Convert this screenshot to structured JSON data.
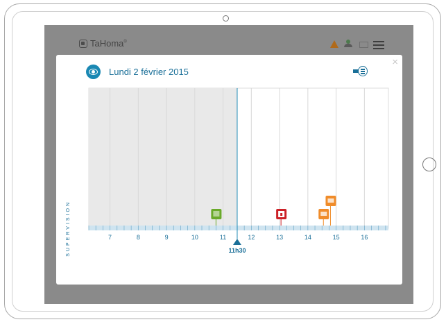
{
  "app": {
    "brand": "TaHoma",
    "brand_mark": "®"
  },
  "header_icons": [
    "warning-icon",
    "user-icon",
    "mail-icon",
    "menu-icon"
  ],
  "dialog": {
    "title": "Lundi 2 février 2015",
    "close_label": "×",
    "side_label": "SUPERVISION"
  },
  "colors": {
    "accent": "#1a88b3",
    "past_shade": "#e9e9e9",
    "green": "#6aaa2a",
    "red": "#cc2127",
    "orange": "#f08c2a"
  },
  "chart_data": {
    "type": "timeline",
    "xlim": [
      6.25,
      16.85
    ],
    "x_ticks": [
      7,
      8,
      9,
      10,
      11,
      12,
      13,
      14,
      15,
      16
    ],
    "tick_labels": [
      "7",
      "8",
      "9",
      "10",
      "11",
      "12",
      "13",
      "14",
      "15",
      "16"
    ],
    "current_time": 11.5,
    "current_time_label": "11h30",
    "events": [
      {
        "time": 10.75,
        "type": "shutter",
        "color": "#6aaa2a",
        "level": 0
      },
      {
        "time": 13.05,
        "type": "lock",
        "color": "#cc2127",
        "level": 0
      },
      {
        "time": 14.55,
        "type": "blind",
        "color": "#f08c2a",
        "level": 0
      },
      {
        "time": 14.8,
        "type": "blind",
        "color": "#f08c2a",
        "level": 1
      }
    ]
  }
}
